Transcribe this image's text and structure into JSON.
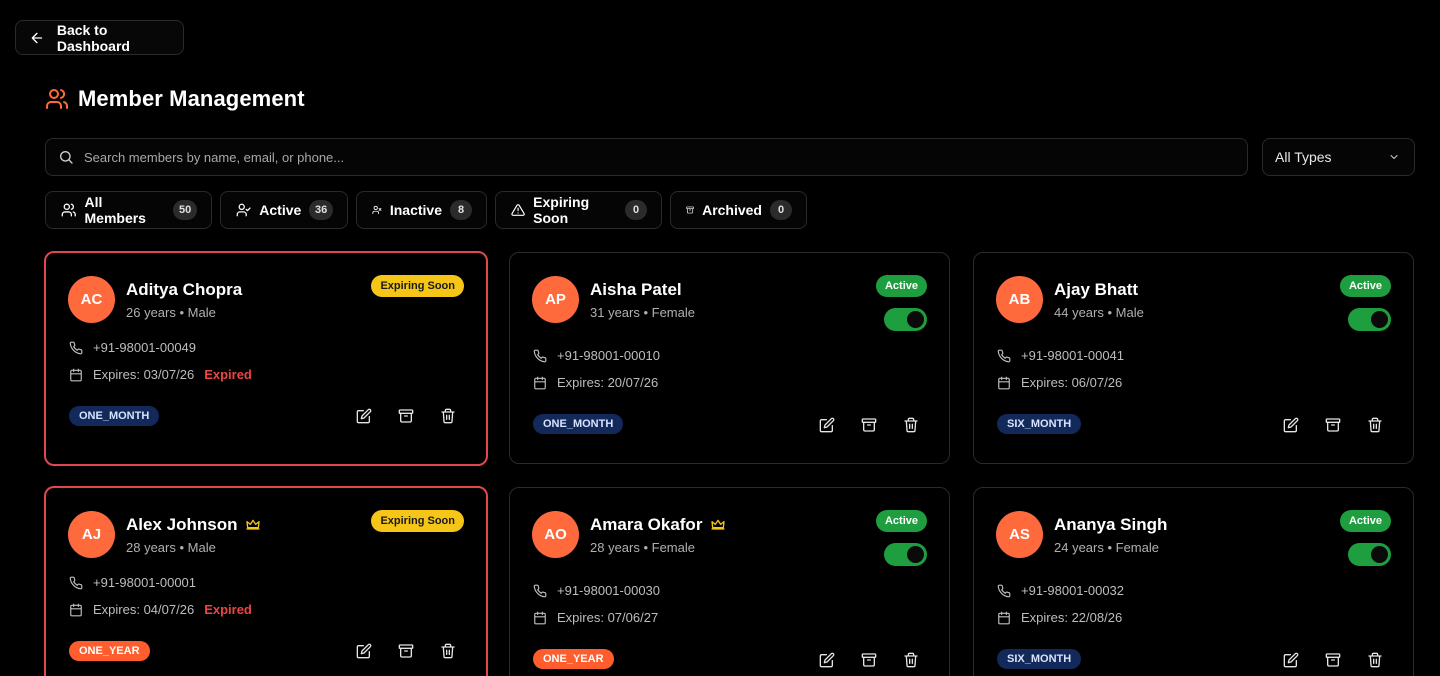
{
  "nav": {
    "back_label": "Back to Dashboard"
  },
  "page": {
    "title": "Member Management"
  },
  "search": {
    "placeholder": "Search members by name, email, or phone...",
    "value": ""
  },
  "type_filter": {
    "selected": "All Types"
  },
  "tabs": [
    {
      "label": "All Members",
      "count": "50",
      "icon": "users-icon"
    },
    {
      "label": "Active",
      "count": "36",
      "icon": "user-check-icon"
    },
    {
      "label": "Inactive",
      "count": "8",
      "icon": "user-x-icon"
    },
    {
      "label": "Expiring Soon",
      "count": "0",
      "icon": "alert-triangle-icon"
    },
    {
      "label": "Archived",
      "count": "0",
      "icon": "archive-icon"
    }
  ],
  "colors": {
    "accent_orange": "#ff6a3d",
    "active_green": "#1e9e3f",
    "expiring_yellow": "#f5c518",
    "expired_red": "#ef4444",
    "warning_border": "#e0484d",
    "plan_blue": "#13295a"
  },
  "members": [
    {
      "initials": "AC",
      "name": "Aditya Chopra",
      "meta": "26 years • Male",
      "status": "Expiring Soon",
      "phone": "+91-98001-00049",
      "expires": "Expires: 03/07/26",
      "expired_label": "Expired",
      "plan": "ONE_MONTH",
      "premium": false
    },
    {
      "initials": "AP",
      "name": "Aisha Patel",
      "meta": "31 years • Female",
      "status": "Active",
      "phone": "+91-98001-00010",
      "expires": "Expires: 20/07/26",
      "plan": "ONE_MONTH",
      "premium": false
    },
    {
      "initials": "AB",
      "name": "Ajay Bhatt",
      "meta": "44 years • Male",
      "status": "Active",
      "phone": "+91-98001-00041",
      "expires": "Expires: 06/07/26",
      "plan": "SIX_MONTH",
      "premium": false
    },
    {
      "initials": "AJ",
      "name": "Alex Johnson",
      "meta": "28 years • Male",
      "status": "Expiring Soon",
      "phone": "+91-98001-00001",
      "expires": "Expires: 04/07/26",
      "expired_label": "Expired",
      "plan": "ONE_YEAR",
      "premium": true
    },
    {
      "initials": "AO",
      "name": "Amara Okafor",
      "meta": "28 years • Female",
      "status": "Active",
      "phone": "+91-98001-00030",
      "expires": "Expires: 07/06/27",
      "plan": "ONE_YEAR",
      "premium": true
    },
    {
      "initials": "AS",
      "name": "Ananya Singh",
      "meta": "24 years • Female",
      "status": "Active",
      "phone": "+91-98001-00032",
      "expires": "Expires: 22/08/26",
      "plan": "SIX_MONTH",
      "premium": false
    }
  ]
}
